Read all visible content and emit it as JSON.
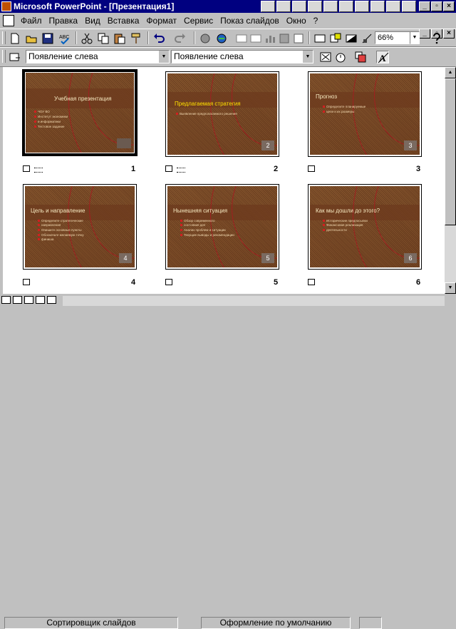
{
  "window": {
    "title": "Microsoft PowerPoint - [Презентация1]"
  },
  "menu": [
    "Файл",
    "Правка",
    "Вид",
    "Вставка",
    "Формат",
    "Сервис",
    "Показ слайдов",
    "Окно",
    "?"
  ],
  "toolbar": {
    "zoom": "66%"
  },
  "sorter_toolbar": {
    "transition_effect": "Появление слева",
    "text_effect": "Появление слева"
  },
  "icons": {
    "new": "new-document-icon",
    "open": "open-folder-icon",
    "save": "save-icon",
    "spell": "spellcheck-icon",
    "cut": "cut-icon",
    "copy": "copy-icon",
    "paste": "paste-icon",
    "painter": "format-painter-icon",
    "undo": "undo-icon",
    "redo": "redo-icon",
    "help": "help-icon"
  },
  "slides": [
    {
      "number": "1",
      "title": "Учебная презентация",
      "bullets": [
        "ЧОУ ВО",
        "Институт экономики",
        "и информатики",
        "Тестовое задание"
      ]
    },
    {
      "number": "2",
      "title": "Предлагаемая стратегия",
      "bullets": [
        "Выявление предполагаемого решения"
      ]
    },
    {
      "number": "3",
      "title": "Прогноз",
      "bullets": [
        "Определите планируемые",
        "цели и их размеры"
      ]
    },
    {
      "number": "4",
      "title": "Цель и направление",
      "bullets": [
        "Определите стратегические",
        "направления",
        "Опишите основные пункты",
        "Обозначьте желаемую точку",
        "финиша"
      ]
    },
    {
      "number": "5",
      "title": "Нынешняя ситуация",
      "bullets": [
        "Обзор современного",
        "состояния дел",
        "Анализ проблем и ситуации",
        "Текущие выводы и рекомендации"
      ]
    },
    {
      "number": "6",
      "title": "Как мы дошли до этого?",
      "bullets": [
        "Исторические предпосылки",
        "Финансовая реализация",
        "деятельности"
      ]
    }
  ],
  "status": {
    "view": "Сортировщик слайдов",
    "design": "Оформление по умолчанию"
  },
  "colors": {
    "titlebar": "#000080",
    "chrome": "#c0c0c0",
    "slide_bg": "#7a4a28",
    "accent": "#a02020"
  }
}
